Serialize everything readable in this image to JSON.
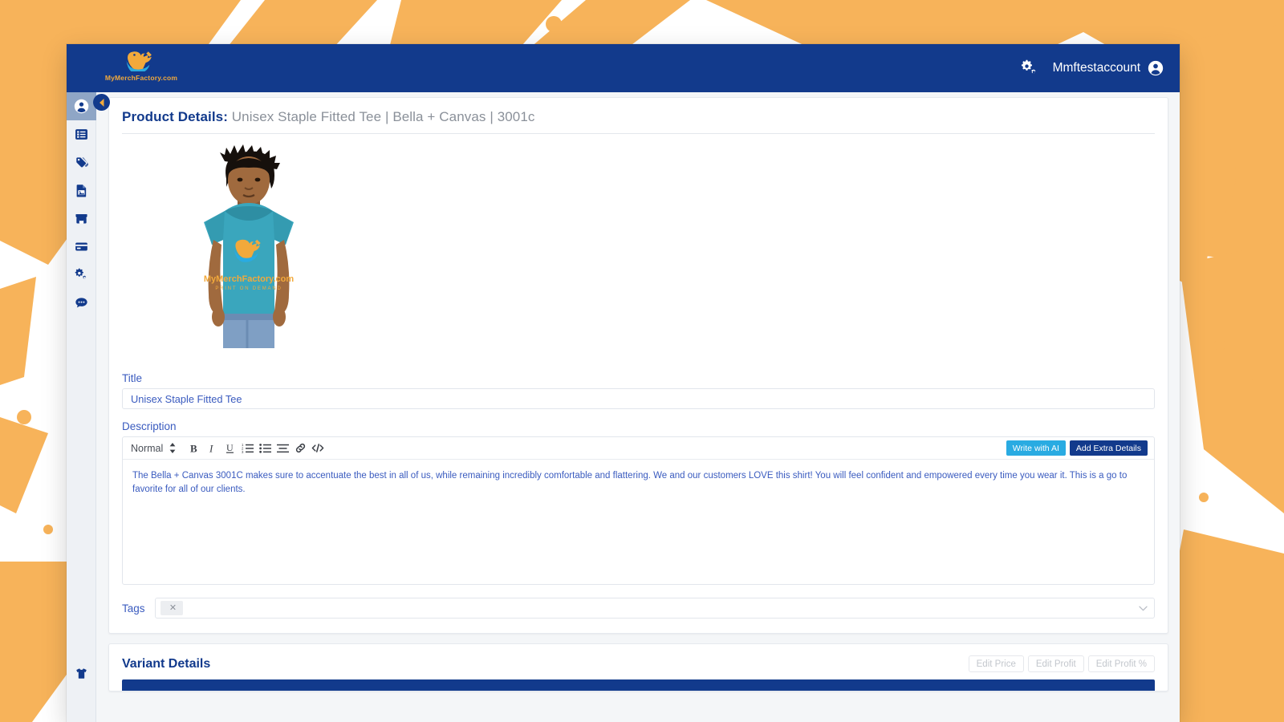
{
  "topbar": {
    "brand_name": "MyMerchFactory.com",
    "brand_logo_icon": "bird-logo-icon",
    "settings_icon": "gears-icon",
    "account_name": "Mmftestaccount",
    "account_icon": "person-circle-icon"
  },
  "sidebar": {
    "collapse_icon": "chevron-left-icon",
    "items": [
      {
        "icon": "account-circle-icon",
        "name": "account",
        "active": true
      },
      {
        "icon": "list-icon",
        "name": "orders",
        "active": false
      },
      {
        "icon": "tags-icon",
        "name": "tags",
        "active": false
      },
      {
        "icon": "image-file-icon",
        "name": "designs",
        "active": false
      },
      {
        "icon": "store-icon",
        "name": "stores",
        "active": false
      },
      {
        "icon": "credit-card-icon",
        "name": "billing",
        "active": false
      },
      {
        "icon": "gears-icon",
        "name": "settings",
        "active": false
      },
      {
        "icon": "chat-bubble-icon",
        "name": "support",
        "active": false
      }
    ],
    "bottom_item": {
      "icon": "tshirt-icon",
      "name": "products"
    }
  },
  "details": {
    "heading_label": "Product Details:",
    "heading_value": "Unisex Staple Fitted Tee | Bella + Canvas | 3001c",
    "product_image_alt": "model-wearing-teal-tshirt",
    "product_image_shirt_color": "#3aa6bd",
    "title_label": "Title",
    "title_value": "Unisex Staple Fitted Tee",
    "title_placeholder": "Product title",
    "description_label": "Description",
    "description_value": "The Bella + Canvas 3001C makes sure to accentuate the best in all of us, while remaining incredibly comfortable and flattering. We and our customers LOVE this shirt! You will feel confident and empowered every time you wear it. This is a go to favorite for all of our clients.",
    "tags_label": "Tags",
    "tags_chips": [
      {
        "label": "",
        "remove_icon": "close-icon"
      }
    ],
    "tags_caret_icon": "chevron-down-icon"
  },
  "editor": {
    "format_label": "Normal",
    "stepper_icon": "up-down-arrows-icon",
    "buttons": [
      {
        "icon": "bold-icon",
        "label": "B"
      },
      {
        "icon": "italic-icon",
        "label": "I"
      },
      {
        "icon": "underline-icon",
        "label": "U"
      },
      {
        "icon": "ordered-list-icon",
        "label": ""
      },
      {
        "icon": "bullet-list-icon",
        "label": ""
      },
      {
        "icon": "align-icon",
        "label": ""
      },
      {
        "icon": "link-icon",
        "label": ""
      },
      {
        "icon": "code-icon",
        "label": ""
      }
    ],
    "ai_button_label": "Write with AI",
    "extra_button_label": "Add Extra Details"
  },
  "variant": {
    "title": "Variant Details",
    "edit_price_label": "Edit Price",
    "edit_profit_label": "Edit Profit",
    "edit_profit_pct_label": "Edit Profit %"
  },
  "colors": {
    "brand_navy": "#123a8c",
    "brand_orange": "#f2a93b",
    "accent_cyan": "#29abe2",
    "link_blue": "#3a5bbf",
    "muted_grey": "#8a9099",
    "page_bg": "#f4f6f8"
  }
}
